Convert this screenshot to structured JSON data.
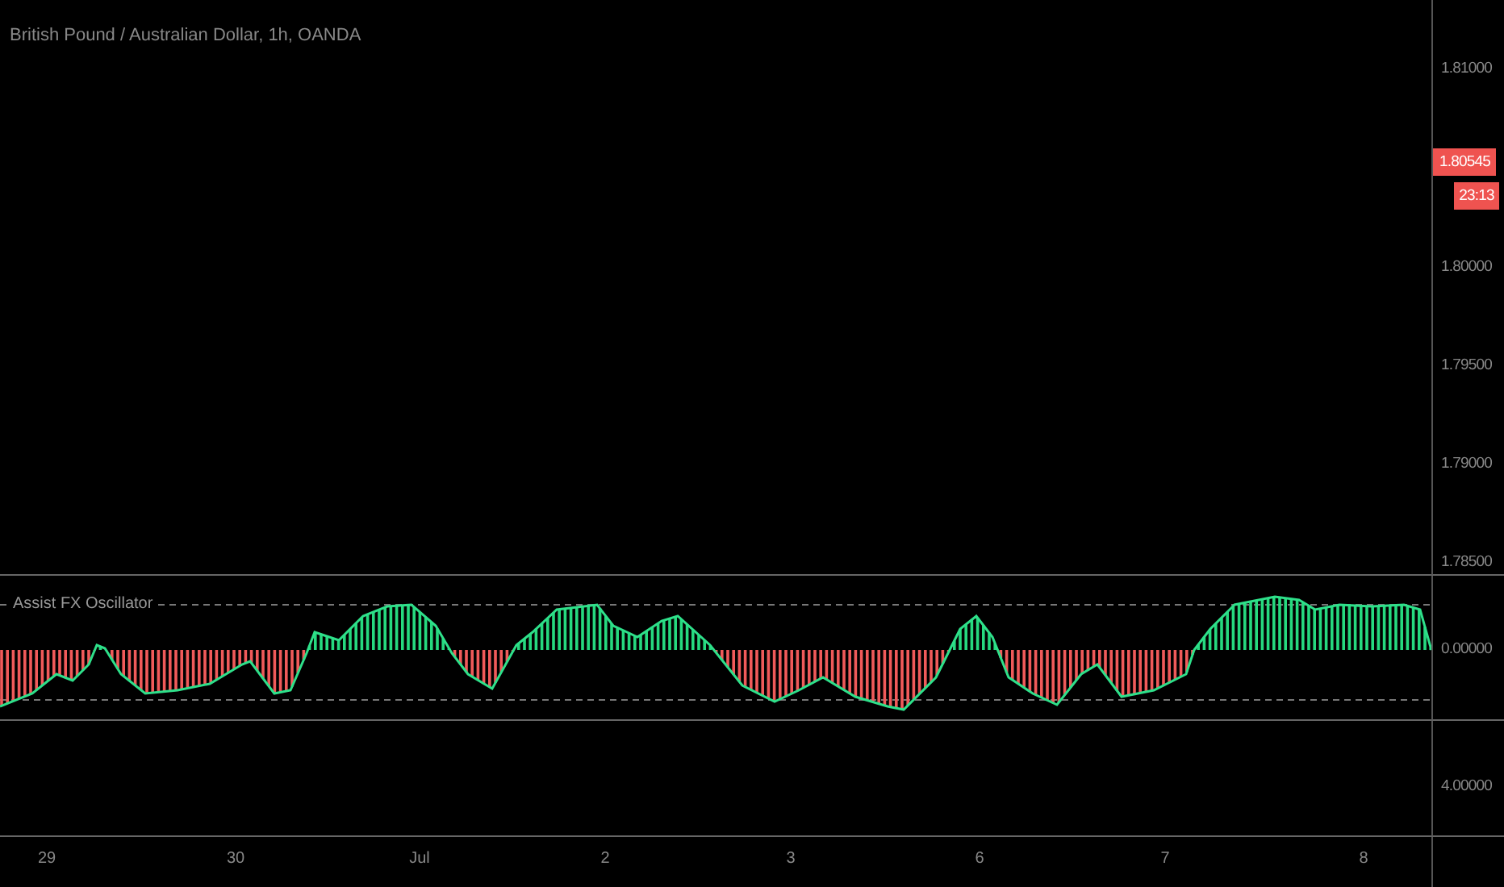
{
  "chart_title": "British Pound / Australian Dollar, 1h, OANDA",
  "price_axis": [
    {
      "kind": "tick",
      "label": "1.81000"
    },
    {
      "kind": "price",
      "label": "1.80545"
    },
    {
      "kind": "countdown",
      "label": "23:13"
    },
    {
      "kind": "tick",
      "label": "1.80000"
    },
    {
      "kind": "tick",
      "label": "1.79500"
    },
    {
      "kind": "tick",
      "label": "1.79000"
    },
    {
      "kind": "tick",
      "label": "1.78500"
    }
  ],
  "oscillator": {
    "title": "Assist FX Oscillator",
    "axis_label": "0.00000"
  },
  "lower_pane": {
    "axis_label": "4.00000"
  },
  "time_axis": [
    "29",
    "30",
    "Jul",
    "2",
    "3",
    "6",
    "7",
    "8"
  ]
}
